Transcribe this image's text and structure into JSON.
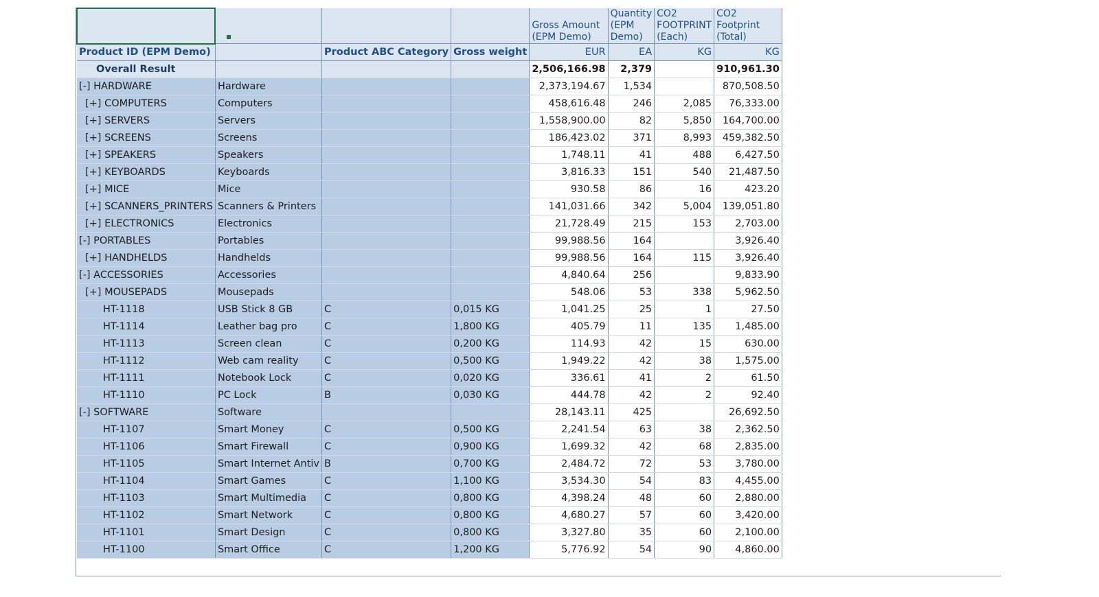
{
  "headers": {
    "top": [
      "",
      "",
      "",
      "",
      "Gross Amount (EPM Demo)",
      "Quantity (EPM Demo)",
      "CO2 FOOTPRINT (Each)",
      "CO2 Footprint (Total)"
    ],
    "second": [
      "Product ID (EPM Demo)",
      "",
      "Product ABC Category",
      "Gross weight",
      "EUR",
      "EA",
      "KG",
      "KG"
    ]
  },
  "overall": {
    "label": "Overall Result",
    "gross": "2,506,166.98",
    "qty": "2,379",
    "each": "",
    "total": "910,961.30"
  },
  "rows": [
    {
      "id": "[-] HARDWARE",
      "name": "Hardware",
      "abc": "",
      "weight": "",
      "gross": "2,373,194.67",
      "qty": "1,534",
      "each": "",
      "total": "870,508.50",
      "level": 0
    },
    {
      "id": "[+] COMPUTERS",
      "name": "Computers",
      "abc": "",
      "weight": "",
      "gross": "458,616.48",
      "qty": "246",
      "each": "2,085",
      "total": "76,333.00",
      "level": 1
    },
    {
      "id": "[+] SERVERS",
      "name": "Servers",
      "abc": "",
      "weight": "",
      "gross": "1,558,900.00",
      "qty": "82",
      "each": "5,850",
      "total": "164,700.00",
      "level": 1
    },
    {
      "id": "[+] SCREENS",
      "name": "Screens",
      "abc": "",
      "weight": "",
      "gross": "186,423.02",
      "qty": "371",
      "each": "8,993",
      "total": "459,382.50",
      "level": 1
    },
    {
      "id": "[+] SPEAKERS",
      "name": "Speakers",
      "abc": "",
      "weight": "",
      "gross": "1,748.11",
      "qty": "41",
      "each": "488",
      "total": "6,427.50",
      "level": 1
    },
    {
      "id": "[+] KEYBOARDS",
      "name": "Keyboards",
      "abc": "",
      "weight": "",
      "gross": "3,816.33",
      "qty": "151",
      "each": "540",
      "total": "21,487.50",
      "level": 1
    },
    {
      "id": "[+] MICE",
      "name": "Mice",
      "abc": "",
      "weight": "",
      "gross": "930.58",
      "qty": "86",
      "each": "16",
      "total": "423.20",
      "level": 1
    },
    {
      "id": "[+] SCANNERS_PRINTERS",
      "name": "Scanners & Printers",
      "abc": "",
      "weight": "",
      "gross": "141,031.66",
      "qty": "342",
      "each": "5,004",
      "total": "139,051.80",
      "level": 1
    },
    {
      "id": "[+] ELECTRONICS",
      "name": "Electronics",
      "abc": "",
      "weight": "",
      "gross": "21,728.49",
      "qty": "215",
      "each": "153",
      "total": "2,703.00",
      "level": 1
    },
    {
      "id": "[-] PORTABLES",
      "name": "Portables",
      "abc": "",
      "weight": "",
      "gross": "99,988.56",
      "qty": "164",
      "each": "",
      "total": "3,926.40",
      "level": 0
    },
    {
      "id": "[+] HANDHELDS",
      "name": "Handhelds",
      "abc": "",
      "weight": "",
      "gross": "99,988.56",
      "qty": "164",
      "each": "115",
      "total": "3,926.40",
      "level": 1
    },
    {
      "id": "[-] ACCESSORIES",
      "name": "Accessories",
      "abc": "",
      "weight": "",
      "gross": "4,840.64",
      "qty": "256",
      "each": "",
      "total": "9,833.90",
      "level": 0
    },
    {
      "id": "[+] MOUSEPADS",
      "name": "Mousepads",
      "abc": "",
      "weight": "",
      "gross": "548.06",
      "qty": "53",
      "each": "338",
      "total": "5,962.50",
      "level": 1
    },
    {
      "id": "HT-1118",
      "name": "USB Stick 8 GB",
      "abc": "C",
      "weight": "0,015 KG",
      "gross": "1,041.25",
      "qty": "25",
      "each": "1",
      "total": "27.50",
      "level": 2
    },
    {
      "id": "HT-1114",
      "name": "Leather bag pro",
      "abc": "C",
      "weight": "1,800 KG",
      "gross": "405.79",
      "qty": "11",
      "each": "135",
      "total": "1,485.00",
      "level": 2
    },
    {
      "id": "HT-1113",
      "name": "Screen clean",
      "abc": "C",
      "weight": "0,200 KG",
      "gross": "114.93",
      "qty": "42",
      "each": "15",
      "total": "630.00",
      "level": 2
    },
    {
      "id": "HT-1112",
      "name": "Web cam reality",
      "abc": "C",
      "weight": "0,500 KG",
      "gross": "1,949.22",
      "qty": "42",
      "each": "38",
      "total": "1,575.00",
      "level": 2
    },
    {
      "id": "HT-1111",
      "name": "Notebook Lock",
      "abc": "C",
      "weight": "0,020 KG",
      "gross": "336.61",
      "qty": "41",
      "each": "2",
      "total": "61.50",
      "level": 2
    },
    {
      "id": "HT-1110",
      "name": "PC Lock",
      "abc": "B",
      "weight": "0,030 KG",
      "gross": "444.78",
      "qty": "42",
      "each": "2",
      "total": "92.40",
      "level": 2
    },
    {
      "id": "[-] SOFTWARE",
      "name": "Software",
      "abc": "",
      "weight": "",
      "gross": "28,143.11",
      "qty": "425",
      "each": "",
      "total": "26,692.50",
      "level": 0
    },
    {
      "id": "HT-1107",
      "name": "Smart Money",
      "abc": "C",
      "weight": "0,500 KG",
      "gross": "2,241.54",
      "qty": "63",
      "each": "38",
      "total": "2,362.50",
      "level": 2
    },
    {
      "id": "HT-1106",
      "name": "Smart Firewall",
      "abc": "C",
      "weight": "0,900 KG",
      "gross": "1,699.32",
      "qty": "42",
      "each": "68",
      "total": "2,835.00",
      "level": 2
    },
    {
      "id": "HT-1105",
      "name": "Smart Internet Antiv",
      "abc": "B",
      "weight": "0,700 KG",
      "gross": "2,484.72",
      "qty": "72",
      "each": "53",
      "total": "3,780.00",
      "level": 2
    },
    {
      "id": "HT-1104",
      "name": "Smart Games",
      "abc": "C",
      "weight": "1,100 KG",
      "gross": "3,534.30",
      "qty": "54",
      "each": "83",
      "total": "4,455.00",
      "level": 2
    },
    {
      "id": "HT-1103",
      "name": "Smart Multimedia",
      "abc": "C",
      "weight": "0,800 KG",
      "gross": "4,398.24",
      "qty": "48",
      "each": "60",
      "total": "2,880.00",
      "level": 2
    },
    {
      "id": "HT-1102",
      "name": "Smart Network",
      "abc": "C",
      "weight": "0,800 KG",
      "gross": "4,680.27",
      "qty": "57",
      "each": "60",
      "total": "3,420.00",
      "level": 2
    },
    {
      "id": "HT-1101",
      "name": "Smart Design",
      "abc": "C",
      "weight": "0,800 KG",
      "gross": "3,327.80",
      "qty": "35",
      "each": "60",
      "total": "2,100.00",
      "level": 2
    },
    {
      "id": "HT-1100",
      "name": "Smart Office",
      "abc": "C",
      "weight": "1,200 KG",
      "gross": "5,776.92",
      "qty": "54",
      "each": "90",
      "total": "4,860.00",
      "level": 2
    }
  ]
}
